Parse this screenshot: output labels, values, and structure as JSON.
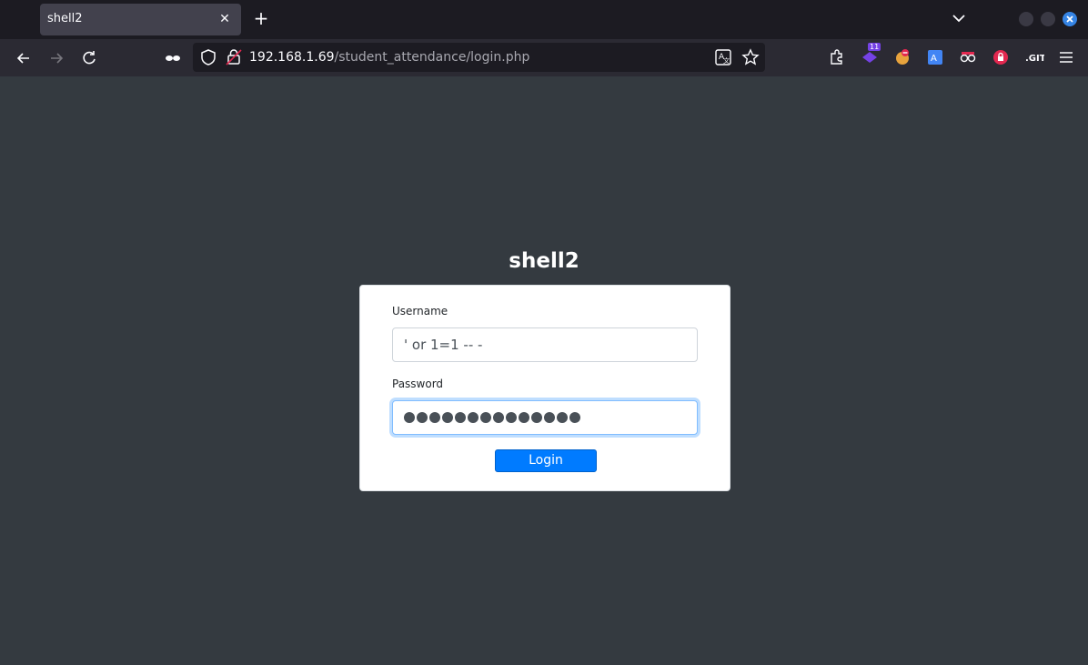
{
  "browser": {
    "tab_title": "shell2",
    "url_host": "192.168.1.69",
    "url_path": "/student_attendance/login.php",
    "extension_badge": "11"
  },
  "page": {
    "title": "shell2",
    "username_label": "Username",
    "username_value": "' or 1=1 -- -",
    "password_label": "Password",
    "password_dots": 14,
    "login_label": "Login"
  },
  "colors": {
    "accent": "#007bff",
    "page_bg": "#343a40",
    "window_close": "#3584e4"
  }
}
